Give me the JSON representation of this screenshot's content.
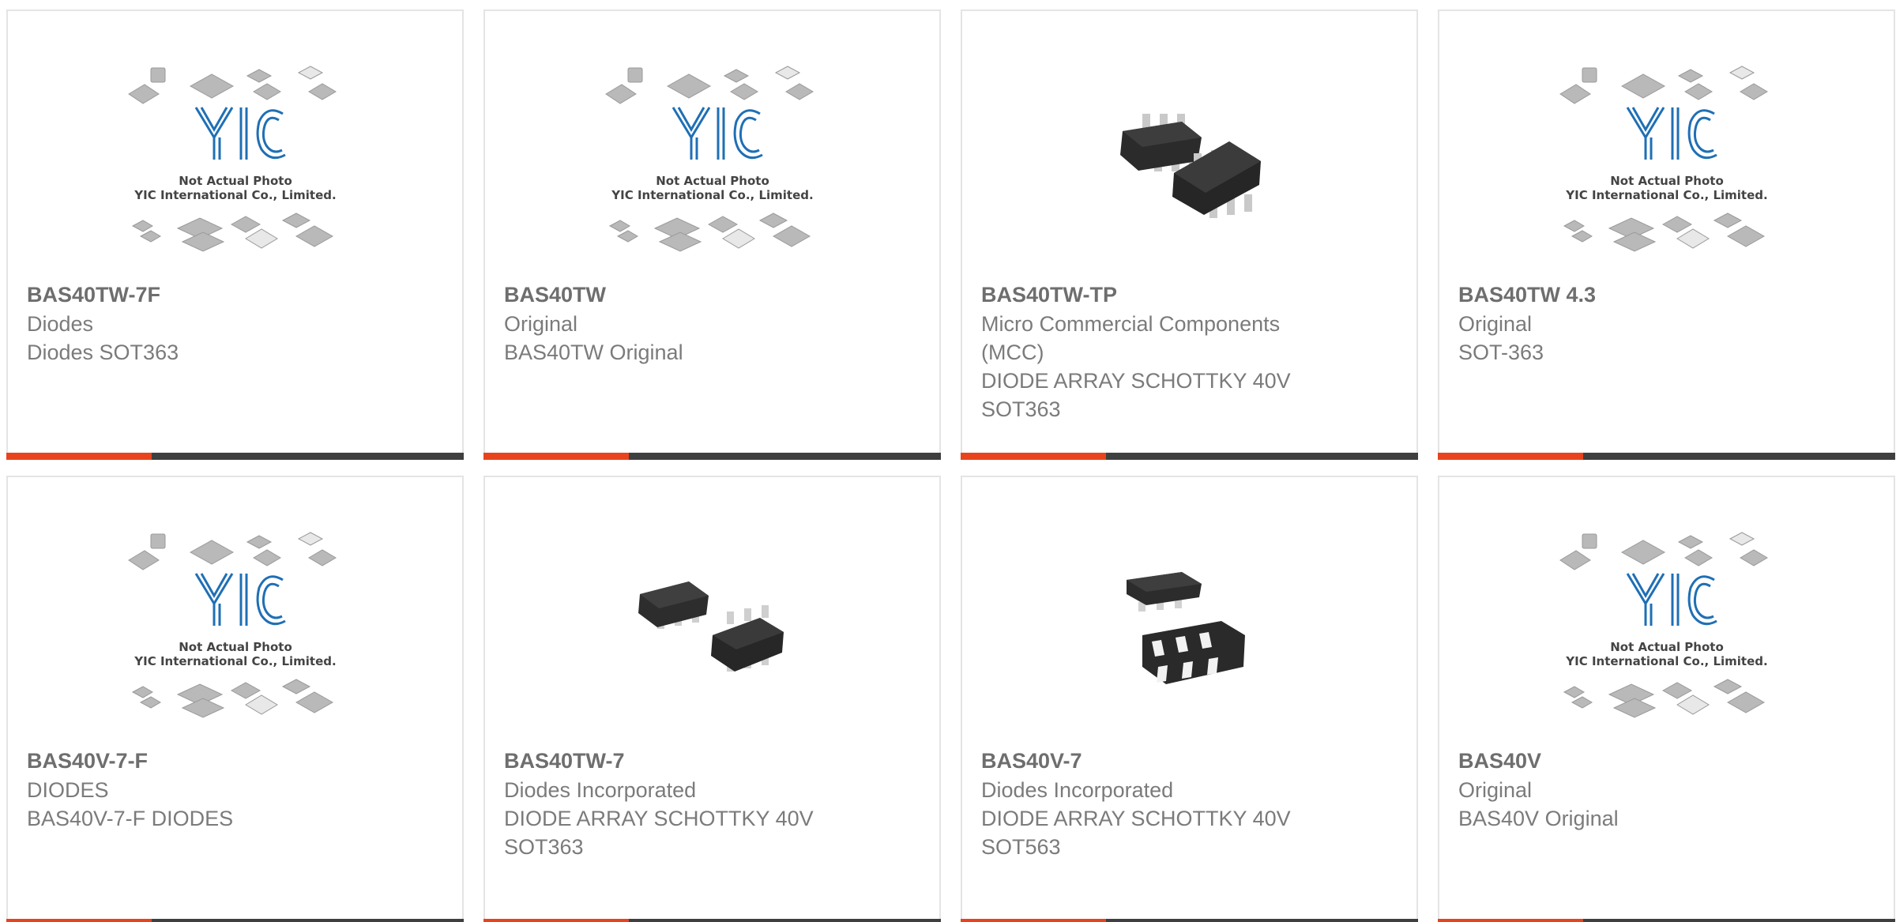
{
  "placeholder": {
    "line1": "Not Actual Photo",
    "line2": "YIC International Co., Limited.",
    "logo": "YIC"
  },
  "colors": {
    "accent": "#e8431c",
    "bar": "#3f3f3f",
    "logo_blue": "#1f6fb5"
  },
  "products": [
    {
      "part": "BAS40TW-7F",
      "mfr": "Diodes",
      "desc": "Diodes SOT363",
      "image": "yic-placeholder"
    },
    {
      "part": "BAS40TW",
      "mfr": "Original",
      "desc": "BAS40TW Original",
      "image": "yic-placeholder"
    },
    {
      "part": "BAS40TW-TP",
      "mfr": "Micro Commercial Components (MCC)",
      "desc": "DIODE ARRAY SCHOTTKY 40V SOT363",
      "image": "sot363-photo"
    },
    {
      "part": "BAS40TW 4.3",
      "mfr": "Original",
      "desc": "SOT-363",
      "image": "yic-placeholder"
    },
    {
      "part": "BAS40V-7-F",
      "mfr": "DIODES",
      "desc": "BAS40V-7-F DIODES",
      "image": "yic-placeholder"
    },
    {
      "part": "BAS40TW-7",
      "mfr": "Diodes Incorporated",
      "desc": "DIODE ARRAY SCHOTTKY 40V SOT363",
      "image": "sot363-photo"
    },
    {
      "part": "BAS40V-7",
      "mfr": "Diodes Incorporated",
      "desc": "DIODE ARRAY SCHOTTKY 40V SOT563",
      "image": "sot563-photo"
    },
    {
      "part": "BAS40V",
      "mfr": "Original",
      "desc": "BAS40V Original",
      "image": "yic-placeholder"
    }
  ]
}
